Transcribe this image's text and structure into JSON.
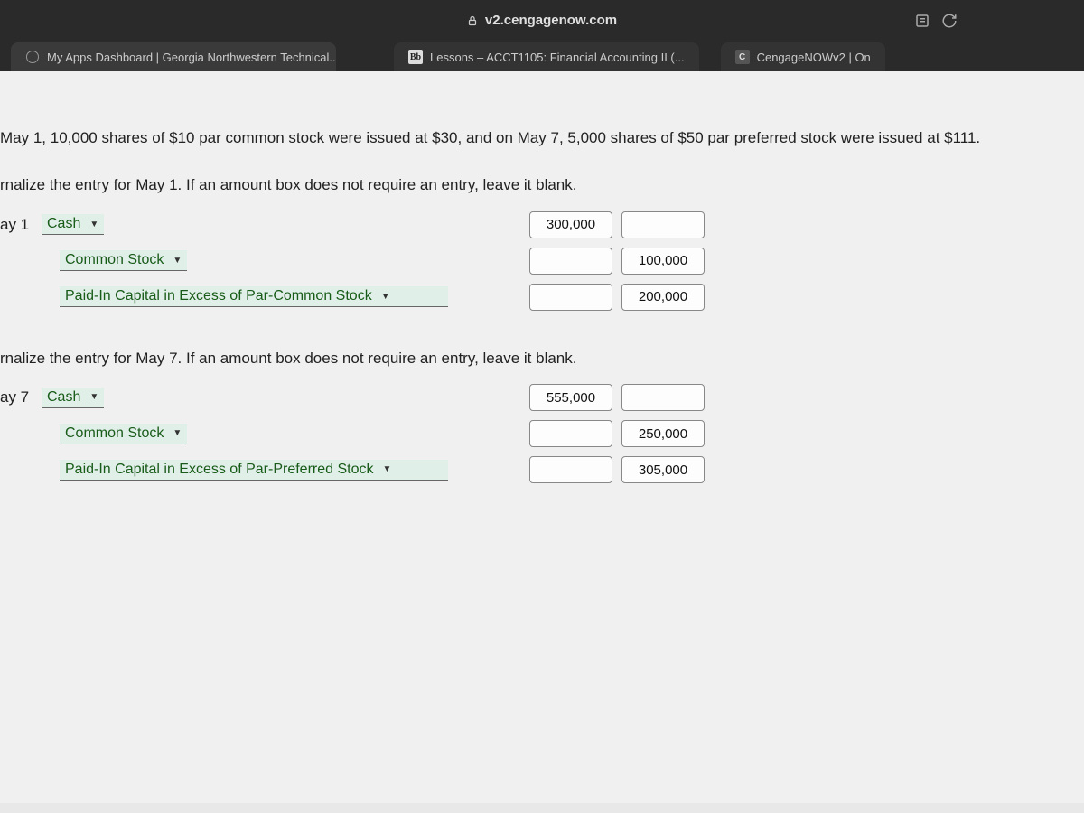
{
  "browser": {
    "url": "v2.cengagenow.com",
    "tabs": [
      {
        "label": "My Apps Dashboard | Georgia Northwestern Technical..."
      },
      {
        "label": "Lessons – ACCT1105: Financial Accounting II (..."
      },
      {
        "label": "CengageNOWv2 | On"
      }
    ],
    "fav_bb": "Bb",
    "fav_c": "C"
  },
  "problem": {
    "intro": "May 1, 10,000 shares of $10 par common stock were issued at $30, and on May 7, 5,000 shares of $50 par preferred stock were issued at $111.",
    "instr1": "rnalize the entry for May 1. If an amount box does not require an entry, leave it blank.",
    "instr2": "rnalize the entry for May 7. If an amount box does not require an entry, leave it blank."
  },
  "entry1": {
    "date_label": "ay 1",
    "row1": {
      "account": "Cash",
      "debit": "300,000",
      "credit": ""
    },
    "row2": {
      "account": "Common Stock",
      "debit": "",
      "credit": "100,000"
    },
    "row3": {
      "account": "Paid-In Capital in Excess of Par-Common Stock",
      "debit": "",
      "credit": "200,000"
    }
  },
  "entry2": {
    "date_label": "ay 7",
    "row1": {
      "account": "Cash",
      "debit": "555,000",
      "credit": ""
    },
    "row2": {
      "account": "Common Stock",
      "debit": "",
      "credit": "250,000"
    },
    "row3": {
      "account": "Paid-In Capital in Excess of Par-Preferred Stock",
      "debit": "",
      "credit": "305,000"
    }
  }
}
